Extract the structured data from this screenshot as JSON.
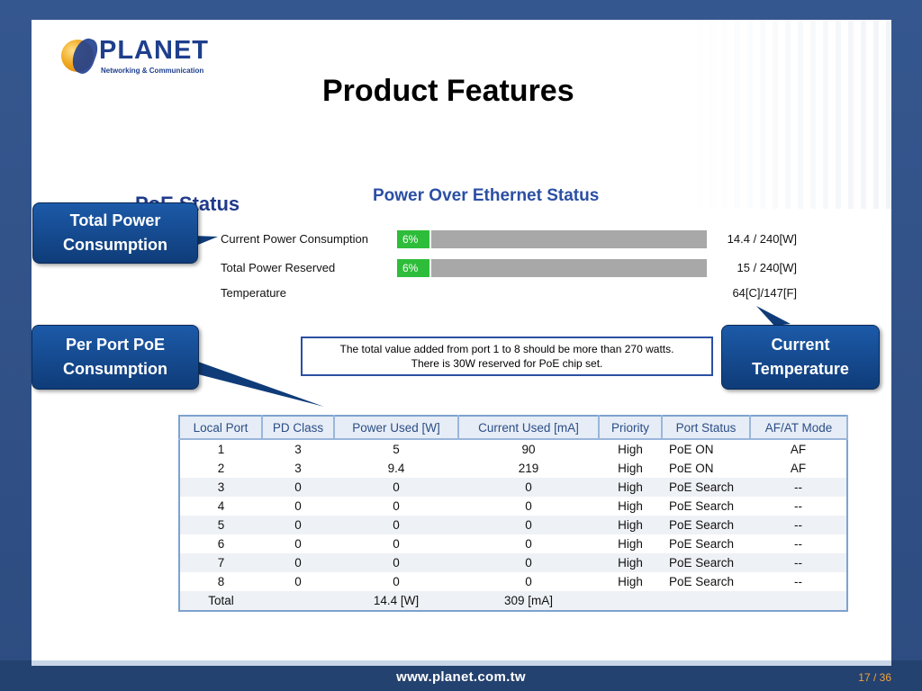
{
  "slide": {
    "title": "Product Features",
    "footer_url": "www.planet.com.tw",
    "page_number": "17 / 36",
    "logo": {
      "name": "PLANET",
      "tagline": "Networking & Communication"
    }
  },
  "poe_heading": "PoE Status",
  "poe_status": {
    "title": "Power Over Ethernet Status",
    "rows": [
      {
        "label": "Current Power Consumption",
        "percent": "6%",
        "value": "14.4 / 240[W]"
      },
      {
        "label": "Total Power Reserved",
        "percent": "6%",
        "value": "15 / 240[W]"
      },
      {
        "label": "Temperature",
        "percent": "",
        "value": "64[C]/147[F]"
      }
    ]
  },
  "callouts": {
    "total_power": "Total Power Consumption",
    "per_port": "Per Port PoE Consumption",
    "current_temp": "Current Temperature"
  },
  "note": {
    "line1": "The total value added from port 1 to 8 should be more than 270 watts.",
    "line2": "There is 30W reserved for PoE chip set."
  },
  "port_table": {
    "headers": [
      "Local Port",
      "PD Class",
      "Power Used [W]",
      "Current Used [mA]",
      "Priority",
      "Port Status",
      "AF/AT Mode"
    ],
    "rows": [
      [
        "1",
        "3",
        "5",
        "90",
        "High",
        "PoE ON",
        "AF"
      ],
      [
        "2",
        "3",
        "9.4",
        "219",
        "High",
        "PoE ON",
        "AF"
      ],
      [
        "3",
        "0",
        "0",
        "0",
        "High",
        "PoE Search",
        "--"
      ],
      [
        "4",
        "0",
        "0",
        "0",
        "High",
        "PoE Search",
        "--"
      ],
      [
        "5",
        "0",
        "0",
        "0",
        "High",
        "PoE Search",
        "--"
      ],
      [
        "6",
        "0",
        "0",
        "0",
        "High",
        "PoE Search",
        "--"
      ],
      [
        "7",
        "0",
        "0",
        "0",
        "High",
        "PoE Search",
        "--"
      ],
      [
        "8",
        "0",
        "0",
        "0",
        "High",
        "PoE Search",
        "--"
      ]
    ],
    "total": [
      "Total",
      "",
      "14.4 [W]",
      "309 [mA]",
      "",
      "",
      ""
    ]
  }
}
